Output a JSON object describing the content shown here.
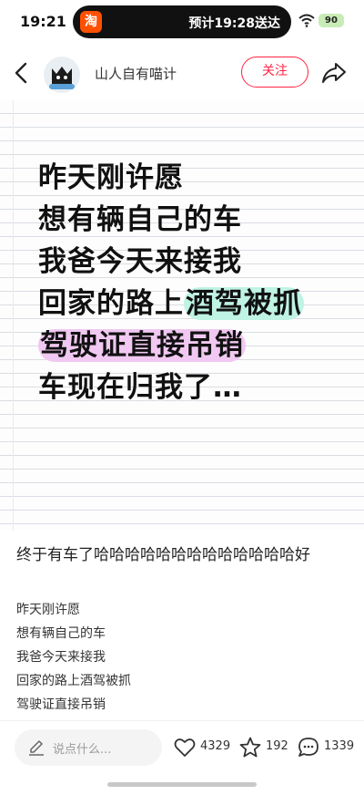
{
  "status_bar": {
    "time": "19:21",
    "app_icon_text": "淘",
    "delivery_text": "预计19:28送达",
    "battery": "90"
  },
  "header": {
    "author_name": "山人自有喵计",
    "follow_label": "关注"
  },
  "note_image": {
    "lines": [
      {
        "plain": "昨天刚许愿",
        "highlight": "",
        "highlight_color": ""
      },
      {
        "plain": "想有辆自己的车",
        "highlight": "",
        "highlight_color": ""
      },
      {
        "plain": "我爸今天来接我",
        "highlight": "",
        "highlight_color": ""
      },
      {
        "plain": "回家的路上",
        "highlight": "酒驾被抓",
        "highlight_color": "#bff3e4"
      },
      {
        "plain": "",
        "highlight": "驾驶证直接吊销",
        "highlight_color": "#f1c8f1"
      },
      {
        "plain": "车现在归我了…",
        "highlight": "",
        "highlight_color": ""
      }
    ]
  },
  "caption": "终于有车了哈哈哈哈哈哈哈哈哈哈哈哈哈好",
  "body_lines": [
    "昨天刚许愿",
    "想有辆自己的车",
    "我爸今天来接我",
    "回家的路上酒驾被抓",
    "驾驶证直接吊销"
  ],
  "bottom_bar": {
    "comment_placeholder": "说点什么...",
    "likes": "4329",
    "favorites": "192",
    "comments": "1339"
  },
  "colors": {
    "accent": "#ff2442",
    "highlight_green": "#bff3e4",
    "highlight_purple": "#f1c8f1"
  },
  "icons": [
    "wifi-icon",
    "back-icon",
    "share-icon",
    "pen-icon",
    "heart-icon",
    "star-icon",
    "comment-icon"
  ]
}
